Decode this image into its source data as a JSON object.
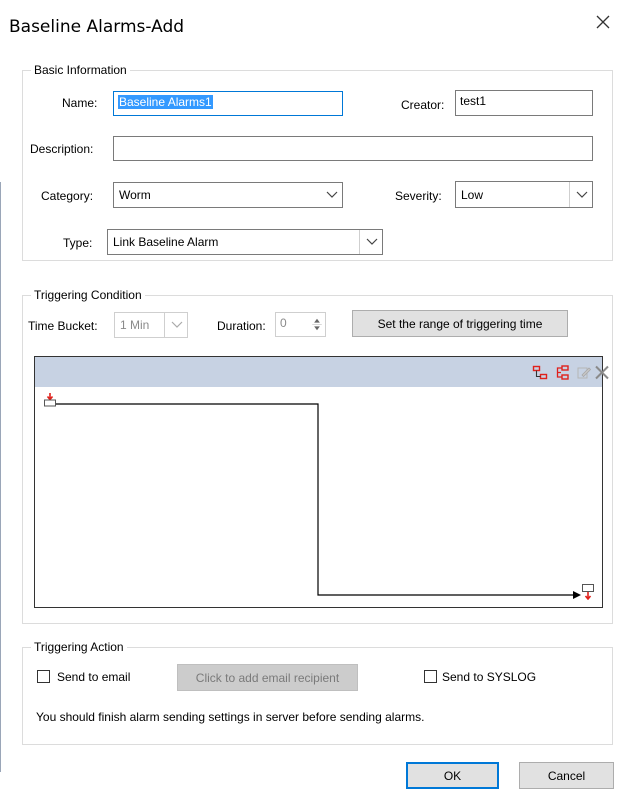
{
  "dialog": {
    "title": "Baseline Alarms-Add"
  },
  "basic": {
    "legend": "Basic Information",
    "name_label": "Name:",
    "name_value": "Baseline Alarms1",
    "creator_label": "Creator:",
    "creator_value": "test1",
    "description_label": "Description:",
    "description_value": "",
    "category_label": "Category:",
    "category_value": "Worm",
    "severity_label": "Severity:",
    "severity_value": "Low",
    "type_label": "Type:",
    "type_value": "Link Baseline Alarm"
  },
  "trigger": {
    "legend": "Triggering Condition",
    "time_bucket_label": "Time Bucket:",
    "time_bucket_value": "1 Min",
    "duration_label": "Duration:",
    "duration_value": "0",
    "range_button": "Set the range of triggering time"
  },
  "diagram": {
    "toolbar_icons": [
      "add-condition-icon",
      "add-group-icon",
      "edit-icon",
      "delete-icon"
    ]
  },
  "action": {
    "legend": "Triggering Action",
    "send_email_label": "Send to email",
    "send_email_checked": false,
    "add_recipient_button": "Click to add email recipient",
    "send_syslog_label": "Send to SYSLOG",
    "send_syslog_checked": false,
    "note": "You should finish alarm sending settings in server before sending alarms."
  },
  "footer": {
    "ok": "OK",
    "cancel": "Cancel"
  },
  "colors": {
    "accent": "#0078d7",
    "toolbar": "#c7d2e3",
    "icon_red": "#e0201b"
  }
}
